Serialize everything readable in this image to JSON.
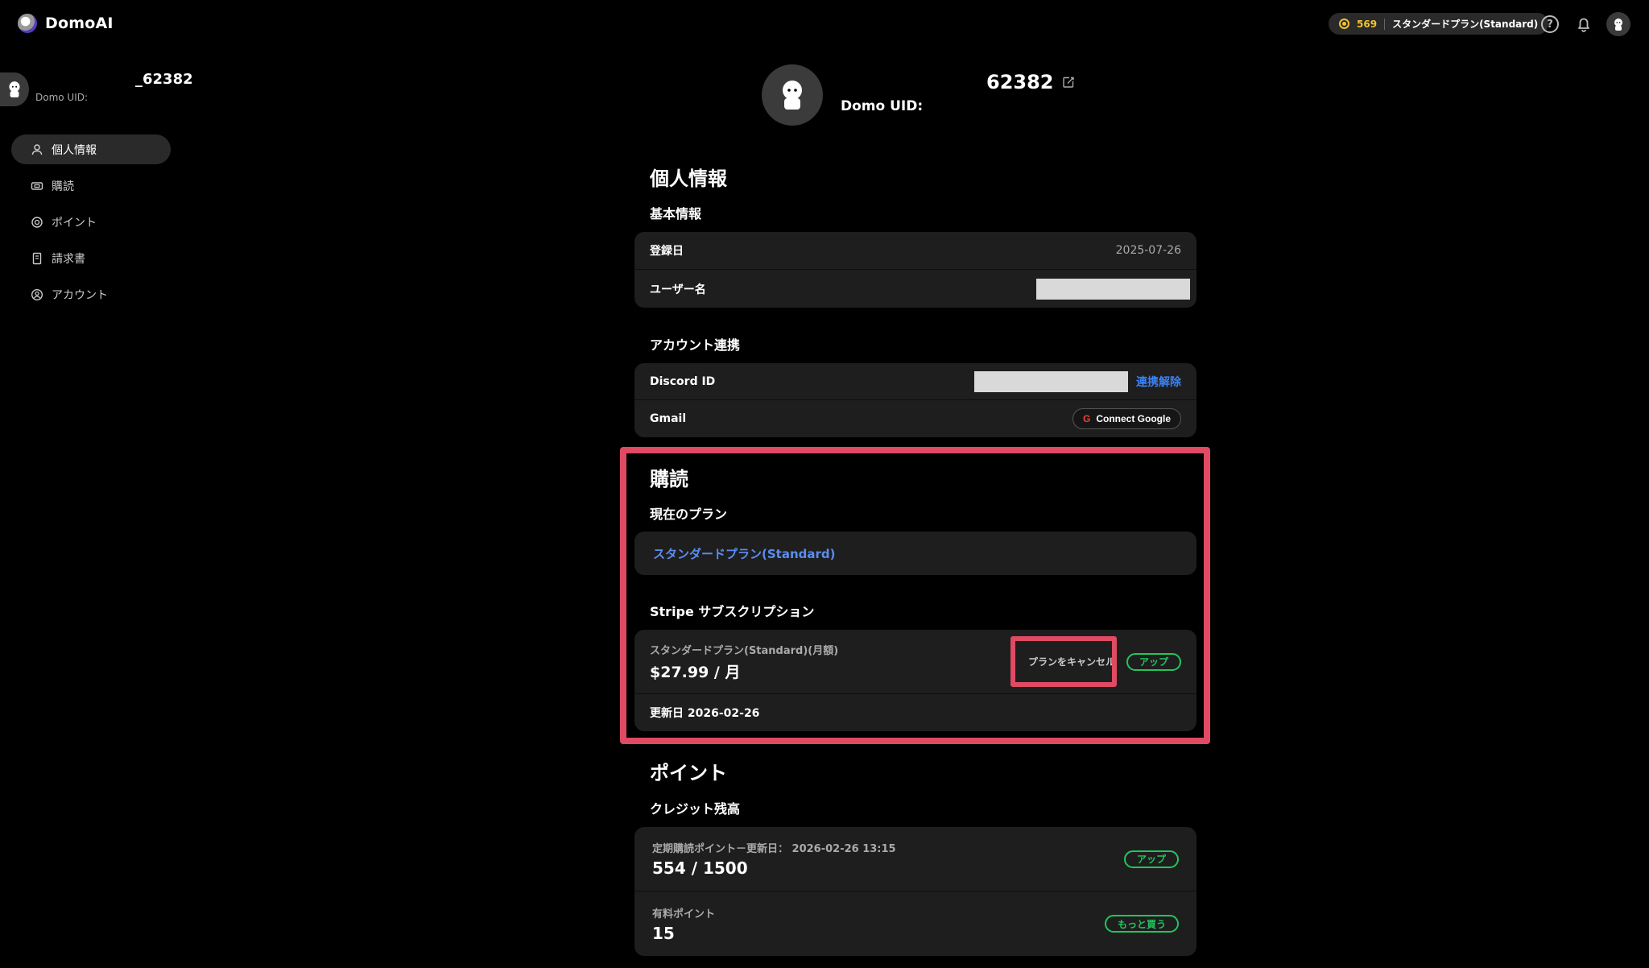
{
  "app": {
    "name": "DomoAI"
  },
  "topbar": {
    "credits": "569",
    "plan": "スタンダードプラン(Standard)"
  },
  "sidebar": {
    "username": "_62382",
    "uid_label": "Domo UID:",
    "items": [
      {
        "label": "個人情報",
        "icon": "user-icon",
        "active": true
      },
      {
        "label": "購読",
        "icon": "ticket-icon"
      },
      {
        "label": "ポイント",
        "icon": "coin-icon"
      },
      {
        "label": "請求書",
        "icon": "document-icon"
      },
      {
        "label": "アカウント",
        "icon": "account-icon"
      }
    ]
  },
  "profile": {
    "name": "62382",
    "uid_label": "Domo UID:"
  },
  "personal": {
    "title": "個人情報",
    "basic_title": "基本情報",
    "registered_label": "登録日",
    "registered_value": "2025-07-26",
    "username_label": "ユーザー名"
  },
  "linking": {
    "title": "アカウント連携",
    "discord_label": "Discord ID",
    "discord_action": "連携解除",
    "gmail_label": "Gmail",
    "google_button": "Connect Google"
  },
  "subscription": {
    "title": "購読",
    "current_plan_title": "現在のプラン",
    "current_plan": "スタンダードプラン(Standard)",
    "stripe_title": "Stripe サブスクリプション",
    "stripe_plan": "スタンダードプラン(Standard)(月額)",
    "stripe_price": "$27.99 / 月",
    "cancel_button": "プランをキャンセル",
    "upgrade_button": "アップ",
    "renewal": "更新日 2026-02-26"
  },
  "points": {
    "title": "ポイント",
    "balance_title": "クレジット残高",
    "subscription_points_label": "定期購読ポイント－更新日： 2026-02-26 13:15",
    "subscription_points_value": "554 / 1500",
    "upgrade_button": "アップ",
    "paid_points_label": "有料ポイント",
    "paid_points_value": "15",
    "buy_more_button": "もっと買う"
  },
  "colors": {
    "accent_green": "#22c55e",
    "link_blue": "#3b82f6",
    "highlight": "#e04a63",
    "coin": "#f1c232"
  }
}
